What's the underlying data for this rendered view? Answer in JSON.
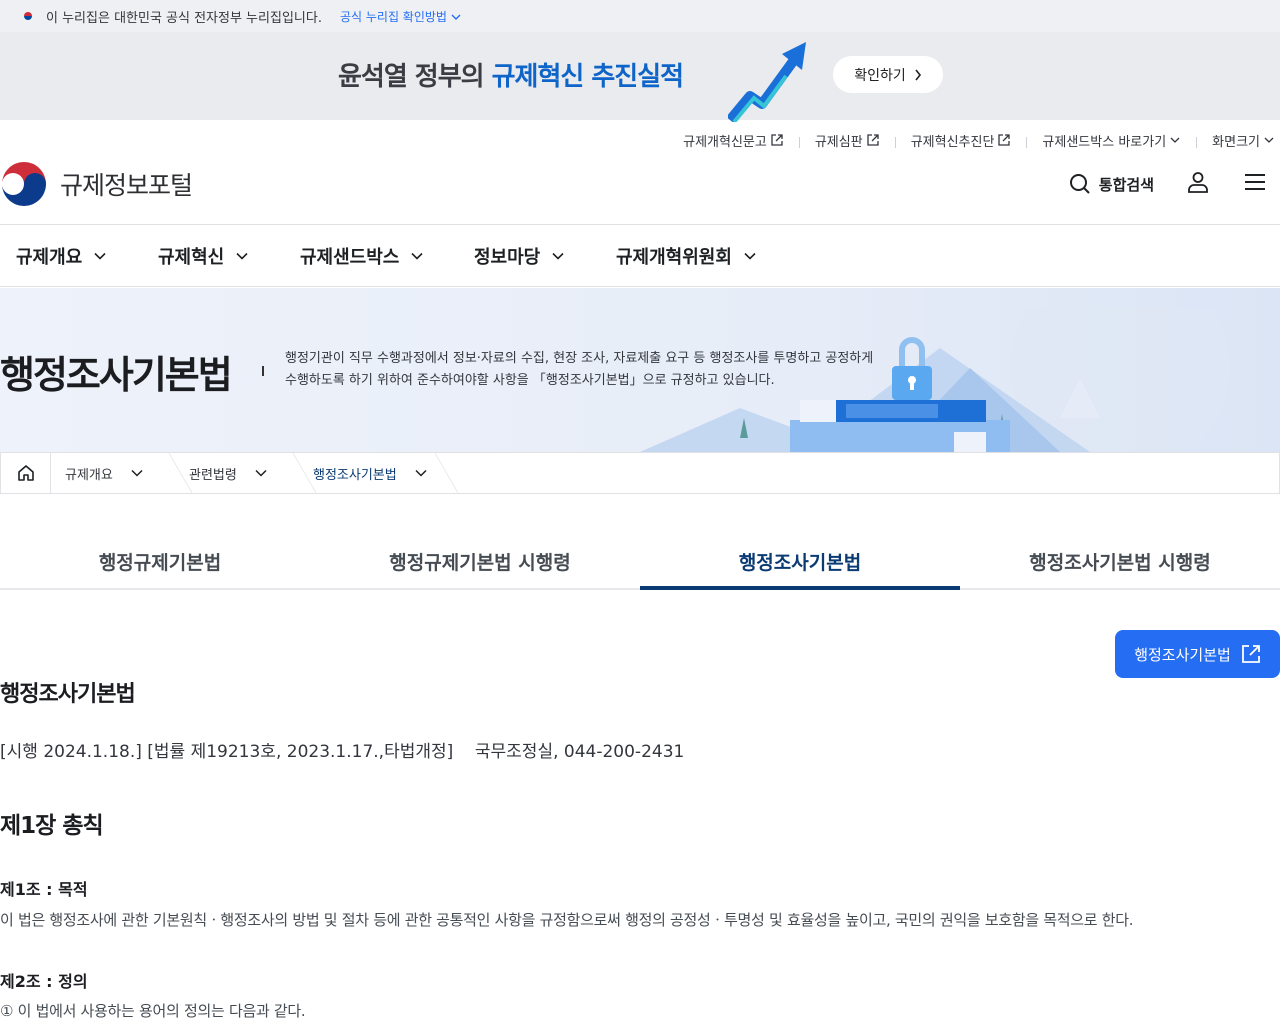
{
  "gov_strip": {
    "notice": "이 누리집은 대한민국 공식 전자정부 누리집입니다.",
    "verify_link": "공식 누리집 확인방법"
  },
  "banner": {
    "title_part1": "윤석열 정부의 ",
    "title_part2": "규제혁신 추진실적",
    "button": "확인하기"
  },
  "utility_links": [
    {
      "label": "규제개혁신문고",
      "icon": "external-link-icon"
    },
    {
      "label": "규제심판",
      "icon": "external-link-icon"
    },
    {
      "label": "규제혁신추진단",
      "icon": "external-link-icon"
    },
    {
      "label": "규제샌드박스 바로가기",
      "icon": "chevron-down-icon"
    },
    {
      "label": "화면크기",
      "icon": "chevron-down-icon"
    }
  ],
  "header": {
    "logo_title": "규제정보포털",
    "search_label": "통합검색"
  },
  "gnb": [
    "규제개요",
    "규제혁신",
    "규제샌드박스",
    "정보마당",
    "규제개혁위원회"
  ],
  "hero": {
    "title": "행정조사기본법",
    "desc_line1": "행정기관이 직무 수행과정에서 정보·자료의 수집, 현장 조사, 자료제출 요구 등 행정조사를 투명하고 공정하게",
    "desc_line2": "수행하도록 하기 위하여 준수하여야할 사항을 「행정조사기본법」으로 규정하고 있습니다."
  },
  "breadcrumb": [
    "규제개요",
    "관련법령",
    "행정조사기본법"
  ],
  "tabs": [
    "행정규제기본법",
    "행정규제기본법 시행령",
    "행정조사기본법",
    "행정조사기본법 시행령"
  ],
  "active_tab": 2,
  "content": {
    "external_button": "행정조사기본법",
    "law_title": "행정조사기본법",
    "law_meta": "[시행 2024.1.18.] [법률 제19213호, 2023.1.17.,타법개정]    국무조정실, 044-200-2431",
    "chapter": "제1장 총칙",
    "article1_title": "제1조 : 목적",
    "article1_text": "이 법은 행정조사에 관한 기본원칙ㆍ행정조사의 방법 및 절차 등에 관한 공통적인 사항을 규정함으로써 행정의 공정성ㆍ투명성 및 효율성을 높이고, 국민의 권익을 보호함을 목적으로 한다.",
    "article2_title": "제2조 : 정의",
    "article2_text": "① 이 법에서 사용하는 용어의 정의는 다음과 같다."
  },
  "colors": {
    "primary": "#256ef4",
    "navy": "#0b3b73",
    "banner_highlight": "#0e64c8"
  }
}
